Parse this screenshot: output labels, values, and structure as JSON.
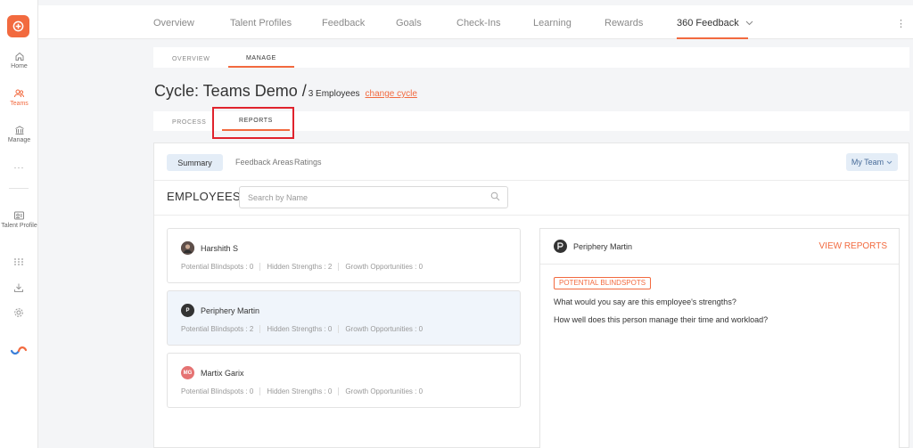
{
  "rail": {
    "items": [
      {
        "label": "Home",
        "icon": "home-icon"
      },
      {
        "label": "Teams",
        "icon": "teams-icon"
      },
      {
        "label": "Manage",
        "icon": "manage-icon"
      },
      {
        "label": "Talent Profile",
        "icon": "talent-profile-icon"
      }
    ],
    "more": "···"
  },
  "topnav": {
    "items": [
      "Overview",
      "Talent Profiles",
      "Feedback",
      "Goals",
      "Check-Ins",
      "Learning",
      "Rewards",
      "360 Feedback"
    ],
    "active": "360 Feedback"
  },
  "subtabs": {
    "overview": "OVERVIEW",
    "manage": "MANAGE"
  },
  "cycle": {
    "title": "Cycle: Teams Demo /",
    "count": "3 Employees",
    "change": "change cycle"
  },
  "phase_tabs": {
    "process": "PROCESS",
    "reports": "REPORTS"
  },
  "report_tabs": {
    "summary": "Summary",
    "feedback_areas": "Feedback Areas",
    "ratings": "Ratings"
  },
  "team_filter": "My Team",
  "employees": {
    "heading": "EMPLOYEES",
    "search_placeholder": "Search by Name",
    "list": [
      {
        "name": "Harshith S",
        "blindspots": "Potential Blindspots : 0",
        "strengths": "Hidden Strengths : 2",
        "growth": "Growth Opportunities : 0"
      },
      {
        "name": "Periphery Martin",
        "blindspots": "Potential Blindspots : 2",
        "strengths": "Hidden Strengths : 0",
        "growth": "Growth Opportunities : 0",
        "initials": "P"
      },
      {
        "name": "Martix Garix",
        "blindspots": "Potential Blindspots : 0",
        "strengths": "Hidden Strengths : 0",
        "growth": "Growth Opportunities : 0",
        "initials": "MG"
      }
    ]
  },
  "detail": {
    "name": "Periphery Martin",
    "view_reports": "VIEW REPORTS",
    "badge": "POTENTIAL BLINDSPOTS",
    "questions": [
      "What would you say are this employee's strengths?",
      "How well does this person manage their time and workload?"
    ]
  },
  "colors": {
    "accent": "#f26a3f",
    "highlight_box": "#e0232d",
    "selected_bg": "#f0f5fb",
    "pill_bg": "#e4edf7"
  }
}
